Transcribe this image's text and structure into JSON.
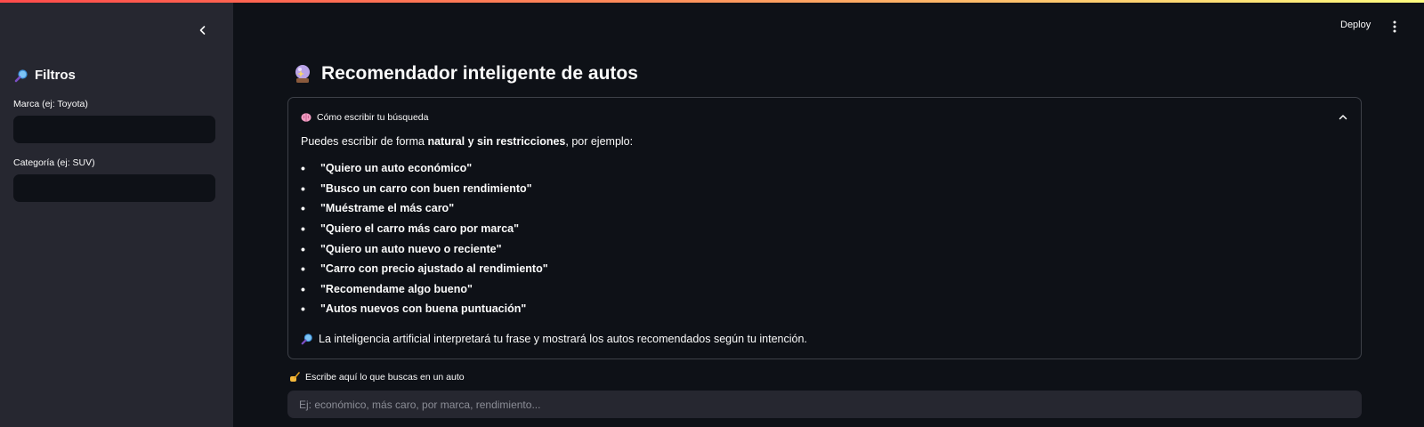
{
  "theme": {
    "background": "#0e1117",
    "sidebar_bg": "#262730",
    "text": "#fafafa",
    "border": "#3d4048"
  },
  "header": {
    "deploy_label": "Deploy"
  },
  "sidebar": {
    "title": "Filtros",
    "title_icon": "magnifier-icon",
    "fields": [
      {
        "label": "Marca (ej: Toyota)",
        "value": ""
      },
      {
        "label": "Categoría (ej: SUV)",
        "value": ""
      }
    ]
  },
  "main": {
    "title": "Recomendador inteligente de autos",
    "title_icon": "crystal-ball-icon",
    "expander": {
      "header": "Cómo escribir tu búsqueda",
      "header_icon": "brain-icon",
      "expanded": true,
      "intro_prefix": "Puedes escribir de forma ",
      "intro_bold": "natural y sin restricciones",
      "intro_suffix": ", por ejemplo:",
      "examples": [
        "\"Quiero un auto económico\"",
        "\"Busco un carro con buen rendimiento\"",
        "\"Muéstrame el más caro\"",
        "\"Quiero el carro más caro por marca\"",
        "\"Quiero un auto nuevo o reciente\"",
        "\"Carro con precio ajustado al rendimiento\"",
        "\"Recomendame algo bueno\"",
        "\"Autos nuevos con buena puntuación\""
      ],
      "footer": "La inteligencia artificial interpretará tu frase y mostrará los autos recomendados según tu intención.",
      "footer_icon": "magnifier-icon"
    },
    "search": {
      "label": "Escribe aquí lo que buscas en un auto",
      "label_icon": "writing-hand-icon",
      "placeholder": "Ej: económico, más caro, por marca, rendimiento...",
      "value": ""
    }
  }
}
